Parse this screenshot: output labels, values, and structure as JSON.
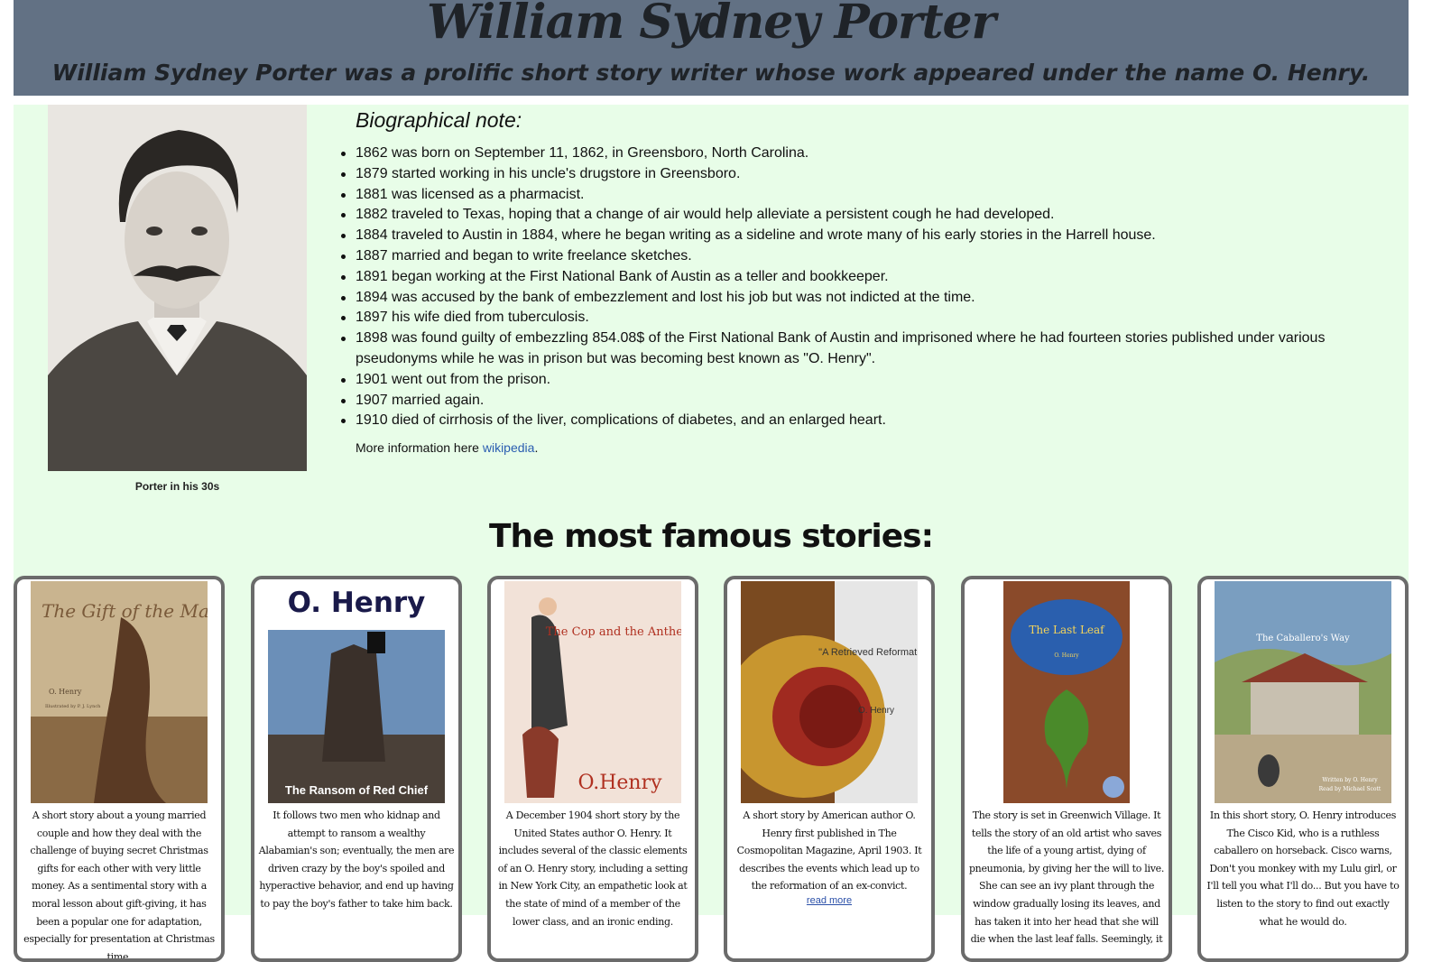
{
  "header": {
    "title": "William Sydney Porter",
    "subtitle": "William Sydney Porter was a prolific short story writer whose work appeared under the name O. Henry."
  },
  "portrait": {
    "caption": "Porter in his 30s"
  },
  "bio": {
    "heading": "Biographical note:",
    "items": [
      "1862 was born on September 11, 1862, in Greensboro, North Carolina.",
      "1879 started working in his uncle's drugstore in Greensboro.",
      "1881 was licensed as a pharmacist.",
      "1882 traveled to Texas, hoping that a change of air would help alleviate a persistent cough he had developed.",
      "1884 traveled to Austin in 1884, where he began writing as a sideline and wrote many of his early stories in the Harrell house.",
      "1887 married and began to write freelance sketches.",
      "1891 began working at the First National Bank of Austin as a teller and bookkeeper.",
      "1894 was accused by the bank of embezzlement and lost his job but was not indicted at the time.",
      "1897 his wife died from tuberculosis.",
      "1898 was found guilty of embezzling 854.08$ of the First National Bank of Austin and imprisoned where he had fourteen stories published under various pseudonyms while he was in prison but was becoming best known as \"O. Henry\".",
      "1901 went out from the prison.",
      "1907 married again.",
      "1910 died of cirrhosis of the liver, complications of diabetes, and an enlarged heart."
    ],
    "more_info_prefix": "More information here ",
    "more_info_link": "wikipedia",
    "more_info_suffix": "."
  },
  "stories": {
    "heading": "The most famous stories:",
    "cards": [
      {
        "cover_title": "The Gift of the Magi",
        "cover_author": "O. Henry",
        "cover_extra": "Illustrated by P. J. Lynch",
        "description": "A short story about a young married couple and how they deal with the challenge of buying secret Christmas gifts for each other with very little money. As a sentimental story with a moral lesson about gift-giving, it has been a popular one for adaptation, especially for presentation at Christmas time."
      },
      {
        "cover_title": "The Ransom of Red Chief",
        "cover_author": "O. Henry",
        "description": "It follows two men who kidnap and attempt to ransom a wealthy Alabamian's son; eventually, the men are driven crazy by the boy's spoiled and hyperactive behavior, and end up having to pay the boy's father to take him back."
      },
      {
        "cover_title": "The Cop and the Anthem",
        "cover_author": "O.Henry",
        "description": "A December 1904 short story by the United States author O. Henry. It includes several of the classic elements of an O. Henry story, including a setting in New York City, an empathetic look at the state of mind of a member of the lower class, and an ironic ending."
      },
      {
        "cover_title": "\"A Retrieved Reformation\"",
        "cover_author": "O. Henry",
        "description": "A short story by American author O. Henry first published in The Cosmopolitan Magazine, April 1903. It describes the events which lead up to the reformation of an ex-convict.",
        "read_more": "read more"
      },
      {
        "cover_title": "The Last Leaf",
        "cover_author": "O. Henry",
        "description": "The story is set in Greenwich Village. It tells the story of an old artist who saves the life of a young artist, dying of pneumonia, by giving her the will to live. She can see an ivy plant through the window gradually losing its leaves, and has taken it into her head that she will die when the last leaf falls. Seemingly, it"
      },
      {
        "cover_title": "The Caballero's Way",
        "cover_author": "Written by O. Henry",
        "cover_extra": "Read by Michael Scott",
        "description": "In this short story, O. Henry introduces The Cisco Kid, who is a ruthless caballero on horseback. Cisco warns, Don't you monkey with my Lulu girl, or I'll tell you what I'll do... But you have to listen to the story to find out exactly what he would do."
      }
    ]
  },
  "colors": {
    "header_bg": "#627184",
    "main_bg": "#e8fde8",
    "link": "#2a5db0",
    "card_border": "#6b6b6b"
  }
}
